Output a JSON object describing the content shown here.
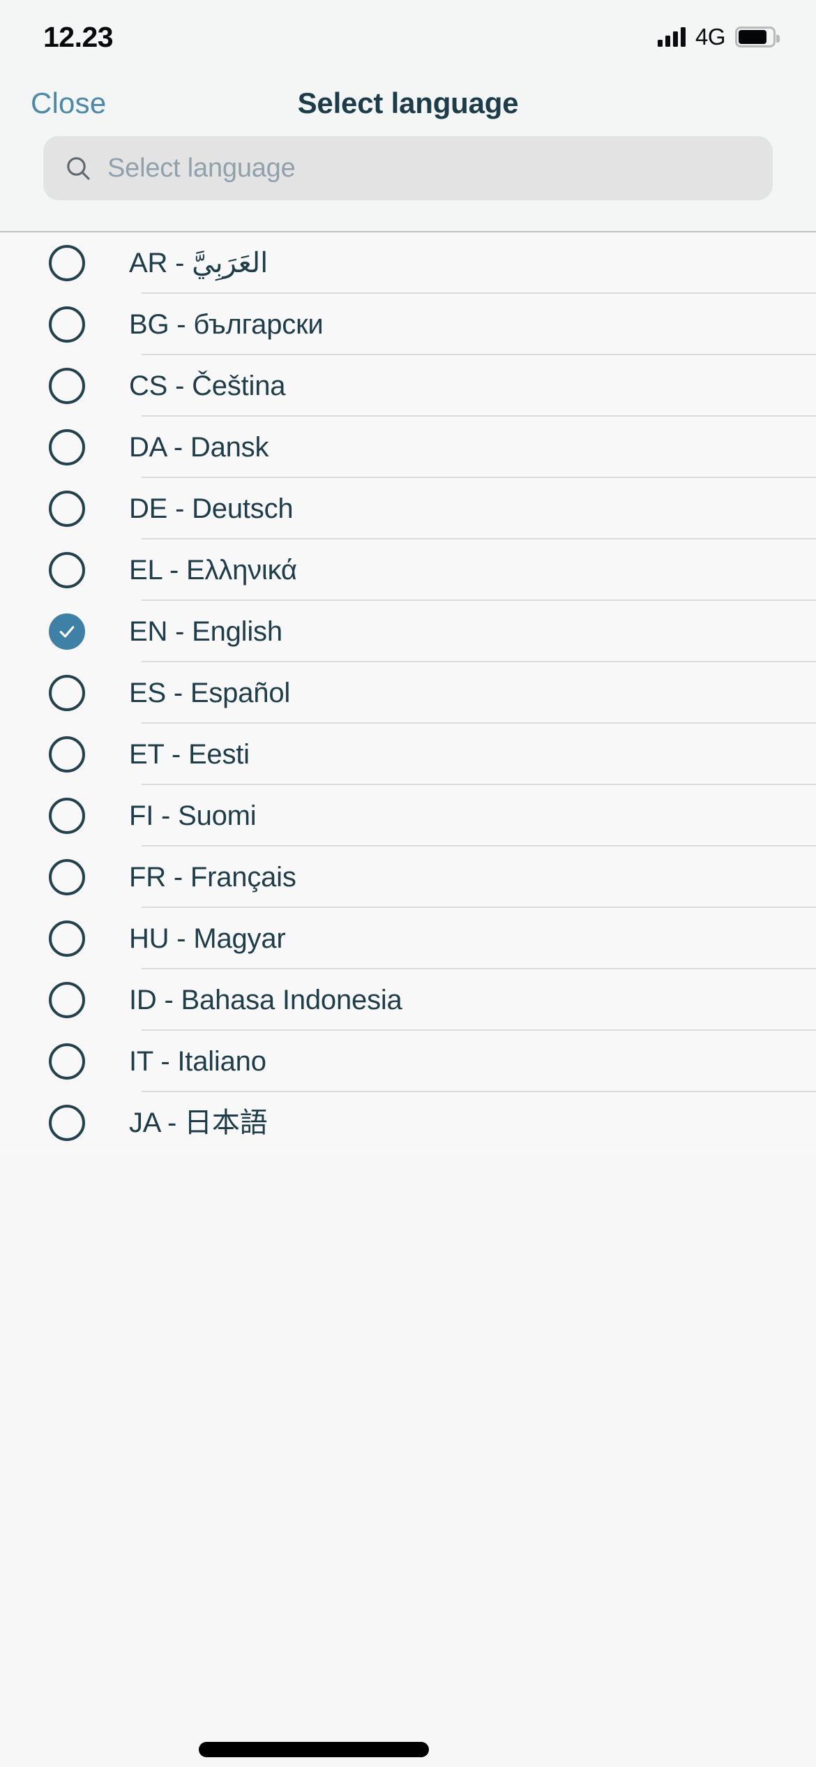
{
  "status_bar": {
    "time": "12.23",
    "network_label": "4G",
    "signal_icon": "signal-bars-icon",
    "battery_icon": "battery-icon",
    "signal_bars": 4,
    "battery_level_percent": 84
  },
  "navbar": {
    "close_label": "Close",
    "title": "Select language"
  },
  "search": {
    "icon": "search-icon",
    "placeholder": "Select language",
    "value": ""
  },
  "colors": {
    "accent": "#3e80a6",
    "link": "#4a89a8",
    "text": "#1e3d4a",
    "title": "#1d3c49",
    "header_bg": "#f4f5f5",
    "list_bg": "#f8f8f8",
    "search_bg": "#e3e3e3",
    "divider": "#d9dcdd",
    "header_rule": "#bfc2c3"
  },
  "language_list": {
    "selected_code": "EN",
    "items": [
      {
        "code": "AR",
        "label": "AR - العَرَبِيَّ",
        "selected": false,
        "rtl": true
      },
      {
        "code": "BG",
        "label": "BG - български",
        "selected": false,
        "rtl": false
      },
      {
        "code": "CS",
        "label": "CS - Čeština",
        "selected": false,
        "rtl": false
      },
      {
        "code": "DA",
        "label": "DA - Dansk",
        "selected": false,
        "rtl": false
      },
      {
        "code": "DE",
        "label": "DE - Deutsch",
        "selected": false,
        "rtl": false
      },
      {
        "code": "EL",
        "label": "EL - Ελληνικά",
        "selected": false,
        "rtl": false
      },
      {
        "code": "EN",
        "label": "EN - English",
        "selected": true,
        "rtl": false
      },
      {
        "code": "ES",
        "label": "ES - Español",
        "selected": false,
        "rtl": false
      },
      {
        "code": "ET",
        "label": "ET - Eesti",
        "selected": false,
        "rtl": false
      },
      {
        "code": "FI",
        "label": "FI - Suomi",
        "selected": false,
        "rtl": false
      },
      {
        "code": "FR",
        "label": "FR - Français",
        "selected": false,
        "rtl": false
      },
      {
        "code": "HU",
        "label": "HU - Magyar",
        "selected": false,
        "rtl": false
      },
      {
        "code": "ID",
        "label": "ID - Bahasa Indonesia",
        "selected": false,
        "rtl": false
      },
      {
        "code": "IT",
        "label": "IT - Italiano",
        "selected": false,
        "rtl": false
      },
      {
        "code": "JA",
        "label": "JA - 日本語",
        "selected": false,
        "rtl": false
      }
    ]
  },
  "home_indicator": {
    "icon": "home-indicator-bar"
  }
}
